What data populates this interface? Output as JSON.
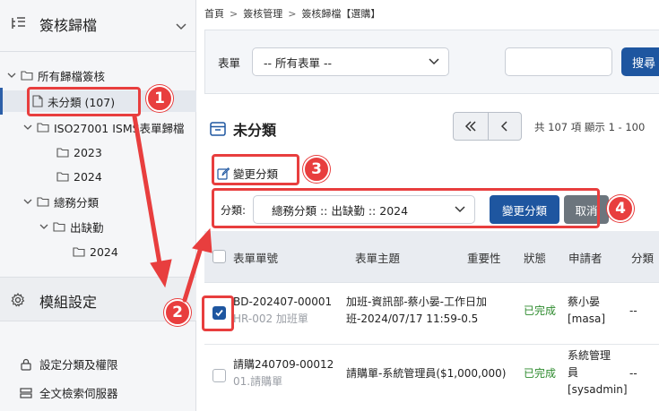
{
  "sidebar": {
    "title": "簽核歸檔",
    "tree": {
      "root": "所有歸檔簽核",
      "uncategorized": "未分類 (107)",
      "iso": "ISO27001 ISMS表單歸檔",
      "iso_2023": "2023",
      "iso_2024": "2024",
      "general": "總務分類",
      "leave": "出缺勤",
      "leave_2024": "2024"
    },
    "module_title": "模組設定",
    "links": [
      "設定分類及權限",
      "全文檢索伺服器"
    ]
  },
  "breadcrumb": [
    "首頁",
    "簽核管理",
    "簽核歸檔【選購】"
  ],
  "filter": {
    "form_label": "表單",
    "form_value": "-- 所有表單 --",
    "search_label": "搜尋"
  },
  "title": "未分類",
  "pager_info": "共 107 項 顯示 1 - 100",
  "change_category_label": "變更分類",
  "category": {
    "label": "分類:",
    "value": "總務分類 :: 出缺勤 :: 2024",
    "submit": "變更分類",
    "cancel": "取消"
  },
  "table": {
    "headers": [
      "表單單號",
      "表單主題",
      "重要性",
      "狀態",
      "申請者",
      "分類"
    ],
    "rows": [
      {
        "id": "BD-202407-00001",
        "form": "HR-002 加班單",
        "subject_line1": "加班-資訊部-蔡小晏-工作日加",
        "subject_line2": "班-2024/07/17 11:59-0.5",
        "status": "已完成",
        "applicant_line1": "蔡小晏",
        "applicant_line2": "[masa]",
        "category": "--"
      },
      {
        "id": "請購240709-00012",
        "form": "01.請購單",
        "subject_line1": "請購單-系統管理員($1,000,000)",
        "subject_line2": "",
        "status": "已完成",
        "applicant_line1": "系統管理",
        "applicant_line2": "員",
        "applicant_line3": "[sysadmin]",
        "category": "--"
      }
    ]
  },
  "annotations": [
    "1",
    "2",
    "3",
    "4"
  ],
  "colors": {
    "primary": "#1e56a0",
    "annotation": "#e83e3e",
    "success": "#2e8b2e"
  }
}
